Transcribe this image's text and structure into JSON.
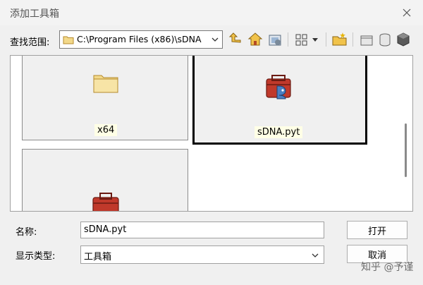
{
  "window": {
    "title": "添加工具箱"
  },
  "toolbar": {
    "look_in_label": "查找范围:",
    "path": "C:\\Program Files (x86)\\sDNA",
    "icons": [
      "up-one-level-icon",
      "home-icon",
      "toolbox-connect-icon",
      "view-menu-icon",
      "new-folder-icon",
      "new-personal-gdb-icon",
      "new-toolbox-icon",
      "catalog-icon"
    ]
  },
  "files": [
    {
      "name": "x64",
      "type": "folder",
      "selected": false
    },
    {
      "name": "sDNA.pyt",
      "type": "python-toolbox",
      "selected": true
    },
    {
      "name": "",
      "type": "toolbox",
      "selected": false
    }
  ],
  "form": {
    "name_label": "名称:",
    "name_value": "sDNA.pyt",
    "type_label": "显示类型:",
    "type_value": "工具箱"
  },
  "buttons": {
    "open": "打开",
    "cancel": "取消"
  },
  "watermark": "知乎 @予谨",
  "colors": {
    "accent_red": "#c0392b",
    "folder_yellow": "#f3d98a"
  }
}
